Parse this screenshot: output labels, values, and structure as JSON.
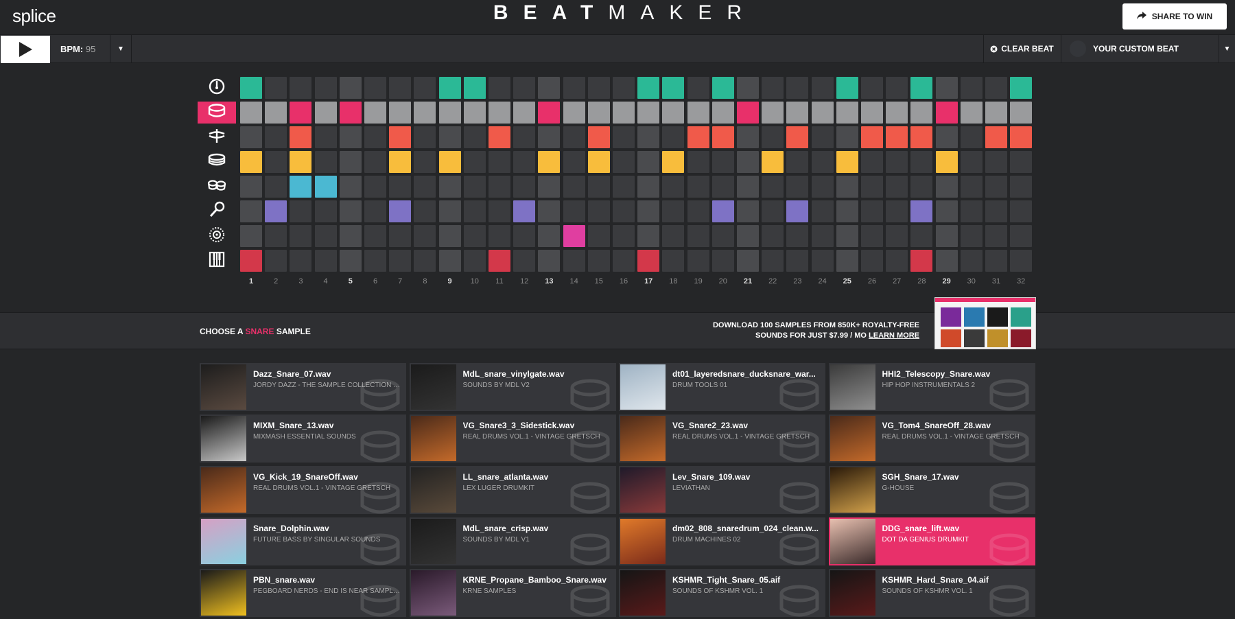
{
  "header": {
    "logo": "splice",
    "brand_bold": "BEAT",
    "brand_thin": "MAKER",
    "share_label": "SHARE TO WIN"
  },
  "controls": {
    "bpm_label": "BPM:",
    "bpm_value": "95",
    "clear_label": "CLEAR BEAT",
    "custom_beat_label": "YOUR CUSTOM BEAT"
  },
  "sequencer": {
    "instruments": [
      {
        "name": "kick",
        "icon": "kick-drum-icon",
        "color": "#2bb996",
        "active": false,
        "steps": [
          1,
          9,
          10,
          17,
          18,
          20,
          25,
          28,
          32
        ]
      },
      {
        "name": "snare",
        "icon": "snare-drum-icon",
        "color": "#e8306a",
        "active": true,
        "steps": [
          3,
          5,
          13,
          21,
          29
        ]
      },
      {
        "name": "hihat",
        "icon": "hihat-icon",
        "color": "#f05a4a",
        "steps": [
          3,
          7,
          11,
          15,
          19,
          20,
          23,
          26,
          27,
          28,
          31,
          32
        ]
      },
      {
        "name": "tom",
        "icon": "tom-drum-icon",
        "color": "#f8bd3c",
        "steps": [
          1,
          3,
          7,
          9,
          13,
          15,
          18,
          22,
          25,
          29
        ]
      },
      {
        "name": "bongo",
        "icon": "bongo-icon",
        "color": "#4bb8d2",
        "steps": [
          3,
          4
        ]
      },
      {
        "name": "vocal",
        "icon": "microphone-icon",
        "color": "#7e72c5",
        "steps": [
          2,
          7,
          12,
          20,
          23,
          28
        ]
      },
      {
        "name": "fx",
        "icon": "fx-icon",
        "color": "#e03ea0",
        "steps": [
          14
        ]
      },
      {
        "name": "keys",
        "icon": "piano-keys-icon",
        "color": "#d3384a",
        "steps": [
          1,
          11,
          17,
          28
        ]
      }
    ],
    "step_count": 32,
    "snare_base_color": "#9a9b9d",
    "empty_color": "#3a3b3e",
    "beat_col_color": "#4a4b4e"
  },
  "sample_section": {
    "choose_prefix": "CHOOSE A",
    "choose_accent": "SNARE",
    "choose_suffix": "SAMPLE",
    "promo_line1": "DOWNLOAD 100 SAMPLES FROM 850K+ ROYALTY-FREE",
    "promo_line2": "SOUNDS FOR JUST $7.99 / MO",
    "promo_link": "LEARN MORE"
  },
  "samples": [
    {
      "name": "Dazz_Snare_07.wav",
      "pack": "JORDY DAZZ - THE SAMPLE COLLECTION PART...",
      "art": [
        "#1d1d1d",
        "#5a4a40"
      ]
    },
    {
      "name": "MdL_snare_vinylgate.wav",
      "pack": "SOUNDS BY MDL V2",
      "art": [
        "#1b1b1b",
        "#333"
      ]
    },
    {
      "name": "dt01_layeredsnare_ducksnare_war...",
      "pack": "DRUM TOOLS 01",
      "art": [
        "#9fb3c4",
        "#dfe6ec"
      ]
    },
    {
      "name": "HHI2_Telescopy_Snare.wav",
      "pack": "HIP HOP INSTRUMENTALS 2",
      "art": [
        "#3b3b3b",
        "#8f8f8f"
      ]
    },
    {
      "name": "MIXM_Snare_13.wav",
      "pack": "MIXMASH ESSENTIAL SOUNDS",
      "art": [
        "#1a1a1a",
        "#c9c9c9"
      ]
    },
    {
      "name": "VG_Snare3_3_Sidestick.wav",
      "pack": "REAL DRUMS VOL.1 - VINTAGE GRETSCH",
      "art": [
        "#4a2a1a",
        "#c46a2a"
      ]
    },
    {
      "name": "VG_Snare2_23.wav",
      "pack": "REAL DRUMS VOL.1 - VINTAGE GRETSCH",
      "art": [
        "#4a2a1a",
        "#c46a2a"
      ]
    },
    {
      "name": "VG_Tom4_SnareOff_28.wav",
      "pack": "REAL DRUMS VOL.1 - VINTAGE GRETSCH",
      "art": [
        "#4a2a1a",
        "#c46a2a"
      ]
    },
    {
      "name": "VG_Kick_19_SnareOff.wav",
      "pack": "REAL DRUMS VOL.1 - VINTAGE GRETSCH",
      "art": [
        "#4a2a1a",
        "#c46a2a"
      ]
    },
    {
      "name": "LL_snare_atlanta.wav",
      "pack": "LEX LUGER DRUMKIT",
      "art": [
        "#222",
        "#5a4a3a"
      ]
    },
    {
      "name": "Lev_Snare_109.wav",
      "pack": "LEVIATHAN",
      "art": [
        "#1f1a2a",
        "#8a3a3a"
      ]
    },
    {
      "name": "SGH_Snare_17.wav",
      "pack": "G-HOUSE",
      "art": [
        "#2a1a0a",
        "#d1a04a"
      ]
    },
    {
      "name": "Snare_Dolphin.wav",
      "pack": "FUTURE BASS BY SINGULAR SOUNDS",
      "art": [
        "#d6a0c4",
        "#8ad0e0"
      ]
    },
    {
      "name": "MdL_snare_crisp.wav",
      "pack": "SOUNDS BY MDL V1",
      "art": [
        "#1b1b1b",
        "#333"
      ]
    },
    {
      "name": "dm02_808_snaredrum_024_clean.w...",
      "pack": "DRUM MACHINES 02",
      "art": [
        "#e07a2a",
        "#7a2a1a"
      ]
    },
    {
      "name": "DDG_snare_lift.wav",
      "pack": "DOT DA GENIUS DRUMKIT",
      "art": [
        "#e8c0b0",
        "#3a2a2a"
      ],
      "selected": true
    },
    {
      "name": "PBN_snare.wav",
      "pack": "PEGBOARD NERDS - END IS NEAR SAMPLE PACK",
      "art": [
        "#1a1a1a",
        "#f0c020"
      ]
    },
    {
      "name": "KRNE_Propane_Bamboo_Snare.wav",
      "pack": "KRNE SAMPLES",
      "art": [
        "#2a1a2a",
        "#7a5a7a"
      ]
    },
    {
      "name": "KSHMR_Tight_Snare_05.aif",
      "pack": "SOUNDS OF KSHMR VOL. 1",
      "art": [
        "#151515",
        "#5a1a1a"
      ]
    },
    {
      "name": "KSHMR_Hard_Snare_04.aif",
      "pack": "SOUNDS OF KSHMR VOL. 1",
      "art": [
        "#151515",
        "#5a1a1a"
      ]
    }
  ]
}
